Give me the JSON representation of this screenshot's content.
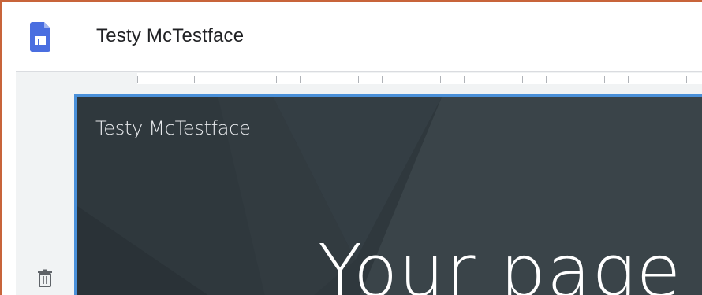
{
  "app": {
    "icon": "google-sites-icon",
    "document_title": "Testy McTestface"
  },
  "sidebar": {
    "trash_icon": "trash-icon"
  },
  "header_section": {
    "site_name": "Testy McTestface",
    "page_title": "Your page",
    "background_color": "#2f383d",
    "selection_color": "#4a90d9"
  },
  "colors": {
    "app_icon": "#4a6ee0",
    "frame_border": "#c8643a"
  }
}
